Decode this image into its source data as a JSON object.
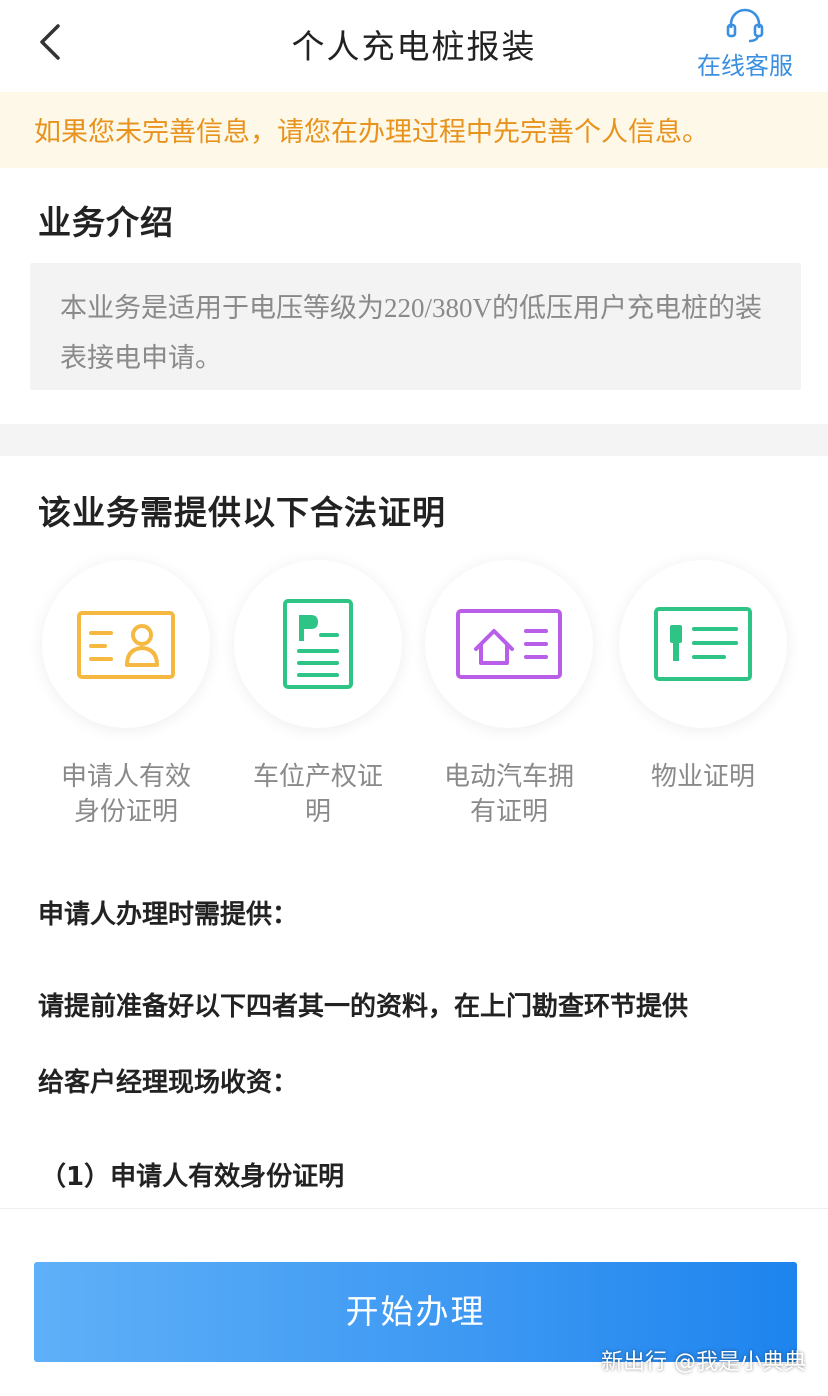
{
  "header": {
    "title": "个人充电桩报装",
    "service_label": "在线客服"
  },
  "notice": {
    "text": "如果您未完善信息，请您在办理过程中先完善个人信息。"
  },
  "intro": {
    "title": "业务介绍",
    "text": "本业务是适用于电压等级为220/380V的低压用户充电桩的装表接电申请。"
  },
  "documents": {
    "title": "该业务需提供以下合法证明",
    "items": [
      {
        "label": "申请人有效身份证明",
        "icon": "id-card-icon",
        "color": "#f5b942"
      },
      {
        "label": "车位产权证明",
        "icon": "parking-certificate-icon",
        "color": "#2ec486"
      },
      {
        "label": "电动汽车拥有证明",
        "icon": "house-certificate-icon",
        "color": "#b85ee8"
      },
      {
        "label": "物业证明",
        "icon": "property-certificate-icon",
        "color": "#2ec486"
      }
    ]
  },
  "requirements": {
    "heading": "申请人办理时需提供：",
    "line1": "请提前准备好以下四者其一的资料，在上门勘查环节提供",
    "line2": "给客户经理现场收资：",
    "item1": "（1）申请人有效身份证明"
  },
  "action": {
    "start_label": "开始办理"
  },
  "watermark": "新出行 @我是小典典",
  "colors": {
    "accent": "#3b97f2",
    "notice_text": "#e8931e",
    "notice_bg": "#fdf8e8"
  }
}
